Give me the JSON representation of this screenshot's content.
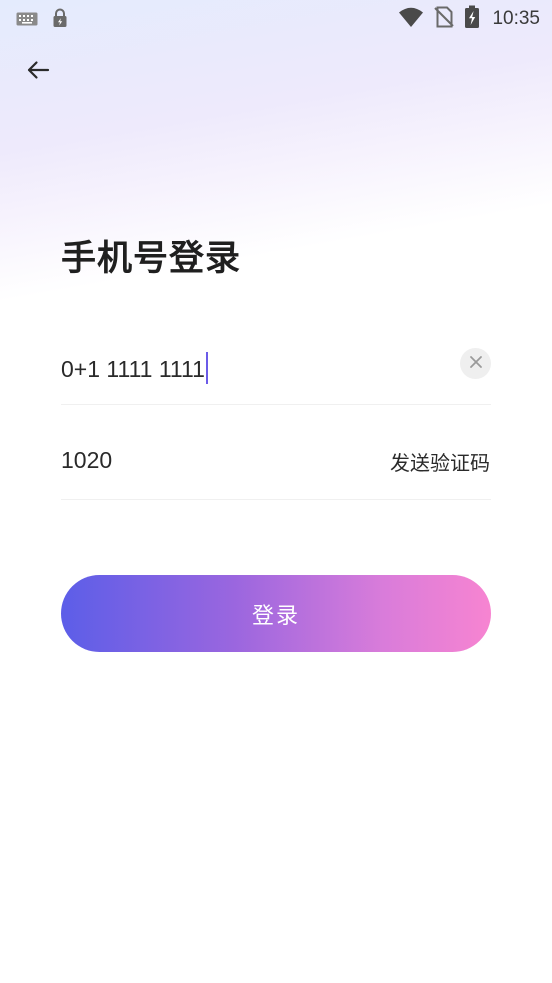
{
  "status_bar": {
    "time": "10:35",
    "icons": [
      "keyboard-icon",
      "lock-icon",
      "wifi-icon",
      "no-sim-icon",
      "battery-charging-icon"
    ]
  },
  "header": {
    "back_icon": "arrow-left-icon"
  },
  "title": "手机号登录",
  "phone_field": {
    "value": "0+1 1111 1111",
    "clear_icon": "close-icon"
  },
  "code_field": {
    "value": "1020",
    "send_label": "发送验证码"
  },
  "login_button": {
    "label": "登录"
  },
  "colors": {
    "caret": "#6b5be8",
    "button_gradient_start": "#5c5ee8",
    "button_gradient_end": "#f784d1"
  }
}
